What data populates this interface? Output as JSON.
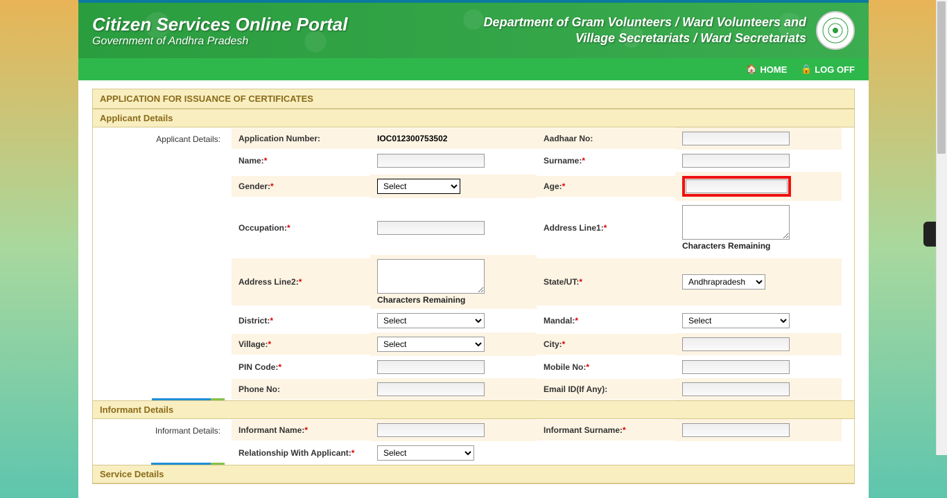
{
  "header": {
    "title": "Citizen Services Online Portal",
    "subtitle": "Government of Andhra Pradesh",
    "dept_line1": "Department of Gram Volunteers / Ward Volunteers and",
    "dept_line2": "Village Secretariats / Ward Secretariats"
  },
  "nav": {
    "home": "HOME",
    "logoff": "LOG OFF"
  },
  "panel": {
    "title": "APPLICATION FOR ISSUANCE OF CERTIFICATES"
  },
  "sections": {
    "applicant": "Applicant Details",
    "informant": "Informant Details",
    "service": "Service Details"
  },
  "tabs": {
    "applicant": "Applicant Details:",
    "informant": "Informant Details:"
  },
  "labels": {
    "application_number": "Application Number:",
    "aadhaar": "Aadhaar No:",
    "name": "Name:",
    "surname": "Surname:",
    "gender": "Gender:",
    "age": "Age:",
    "occupation": "Occupation:",
    "address1": "Address Line1:",
    "address2": "Address Line2:",
    "state": "State/UT:",
    "district": "District:",
    "mandal": "Mandal:",
    "village": "Village:",
    "city": "City:",
    "pincode": "PIN Code:",
    "mobile": "Mobile No:",
    "phone": "Phone No:",
    "email": "Email ID(If Any):",
    "informant_name": "Informant Name:",
    "informant_surname": "Informant Surname:",
    "relationship": "Relationship With Applicant:",
    "chars_remaining": "Characters Remaining"
  },
  "values": {
    "application_number": "IOC012300753502",
    "gender_selected": "Select",
    "state_selected": "Andhrapradesh",
    "district_selected": "Select",
    "mandal_selected": "Select",
    "village_selected": "Select",
    "relationship_selected": "Select"
  },
  "options": {
    "gender": [
      "Select"
    ],
    "state": [
      "Andhrapradesh"
    ],
    "district": [
      "Select"
    ],
    "mandal": [
      "Select"
    ],
    "village": [
      "Select"
    ],
    "relationship": [
      "Select"
    ]
  }
}
